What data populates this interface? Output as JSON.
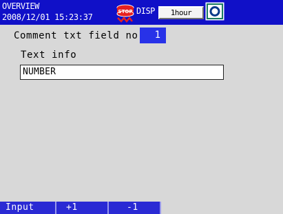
{
  "header": {
    "title": "OVERVIEW",
    "datetime": "2008/12/01 15:23:37",
    "status_icon": "stop-icon",
    "disp_label": "DISP",
    "timescale": "1hour",
    "media_icon": "media-icon",
    "bg_color": "#1010c8"
  },
  "form": {
    "field_no_label": "Comment txt field no",
    "field_no_value": "1",
    "text_info_label": "Text info",
    "text_info_value": "NUMBER"
  },
  "softkeys": [
    {
      "label": "Input"
    },
    {
      "label": "+1"
    },
    {
      "label": "-1"
    }
  ]
}
